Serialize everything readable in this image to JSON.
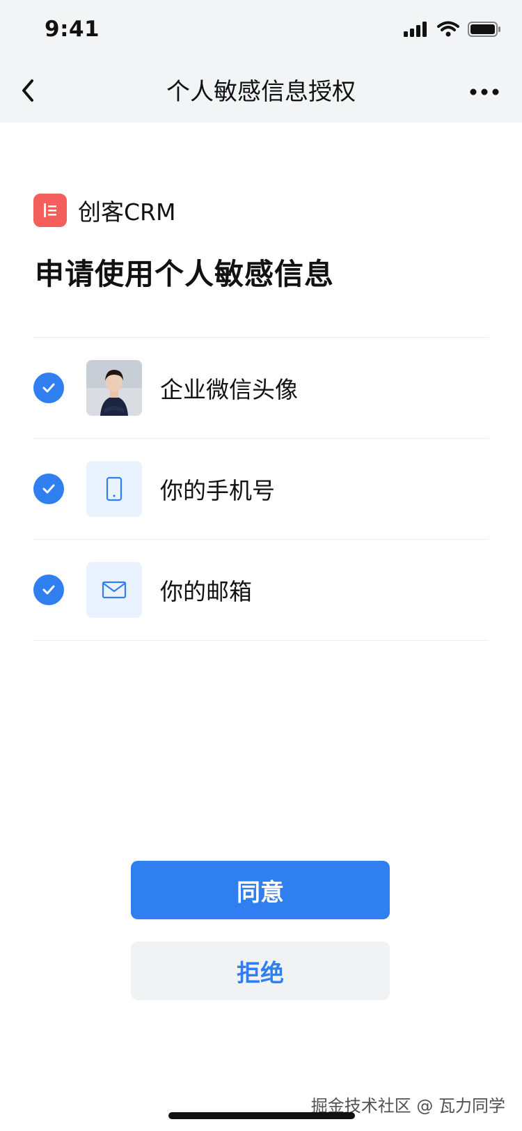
{
  "status_bar": {
    "time": "9:41"
  },
  "nav": {
    "title": "个人敏感信息授权",
    "back_icon": "chevron-left-icon",
    "more_icon": "more-icon"
  },
  "app": {
    "name": "创客CRM",
    "logo_icon": "document-icon",
    "logo_color": "#f25f5c"
  },
  "headline": "申请使用个人敏感信息",
  "items": [
    {
      "label": "企业微信头像",
      "checked": true,
      "icon": "avatar-photo"
    },
    {
      "label": "你的手机号",
      "checked": true,
      "icon": "phone-icon"
    },
    {
      "label": "你的邮箱",
      "checked": true,
      "icon": "mail-icon"
    }
  ],
  "buttons": {
    "agree": "同意",
    "reject": "拒绝"
  },
  "watermark": "掘金技术社区 @ 瓦力同学",
  "colors": {
    "accent": "#2f7ff0",
    "topbar_bg": "#f3f4f6",
    "icon_tile_bg": "#e9f2fe",
    "reject_bg": "#f1f2f4"
  }
}
